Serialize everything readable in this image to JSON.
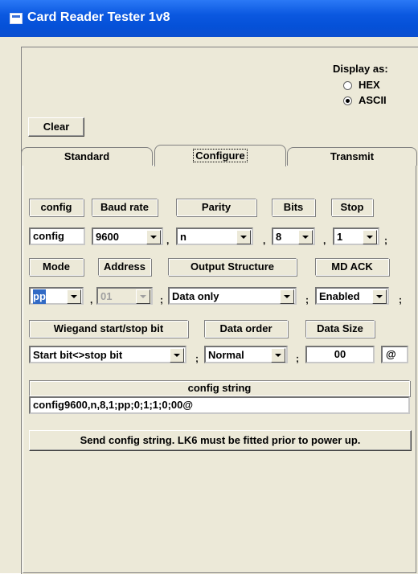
{
  "window": {
    "title": "Card Reader Tester 1v8"
  },
  "display_as": {
    "label": "Display as:",
    "options": [
      {
        "label": "HEX",
        "selected": false
      },
      {
        "label": "ASCII",
        "selected": true
      }
    ]
  },
  "clear_label": "Clear",
  "tabs": [
    {
      "label": "Standard",
      "active": false
    },
    {
      "label": "Configure",
      "active": true
    },
    {
      "label": "Transmit",
      "active": false
    }
  ],
  "row1": {
    "headers": {
      "config": "config",
      "baud": "Baud rate",
      "parity": "Parity",
      "bits": "Bits",
      "stop": "Stop"
    },
    "config_value": "config",
    "baud_value": "9600",
    "parity_value": "n",
    "bits_value": "8",
    "stop_value": "1"
  },
  "row2": {
    "headers": {
      "mode": "Mode",
      "address": "Address",
      "output": "Output Structure",
      "mdack": "MD ACK"
    },
    "mode_value": "pp",
    "address_value": "01",
    "output_value": "Data only",
    "mdack_value": "Enabled"
  },
  "row3": {
    "headers": {
      "wiegand": "Wiegand start/stop bit",
      "order": "Data order",
      "size": "Data Size"
    },
    "wiegand_value": "Start bit<>stop bit",
    "order_value": "Normal",
    "size_value": "00",
    "terminator_value": "@"
  },
  "config_string": {
    "label": "config string",
    "value": "config9600,n,8,1;pp;0;1;1;0;00@"
  },
  "send_label": "Send config string.  LK6 must be fitted prior to power up.",
  "separators": {
    "comma": ",",
    "semicolon": ";"
  },
  "colors": {
    "title_bar": "#0551d8",
    "face": "#ece9d8",
    "selection": "#316ac5"
  }
}
